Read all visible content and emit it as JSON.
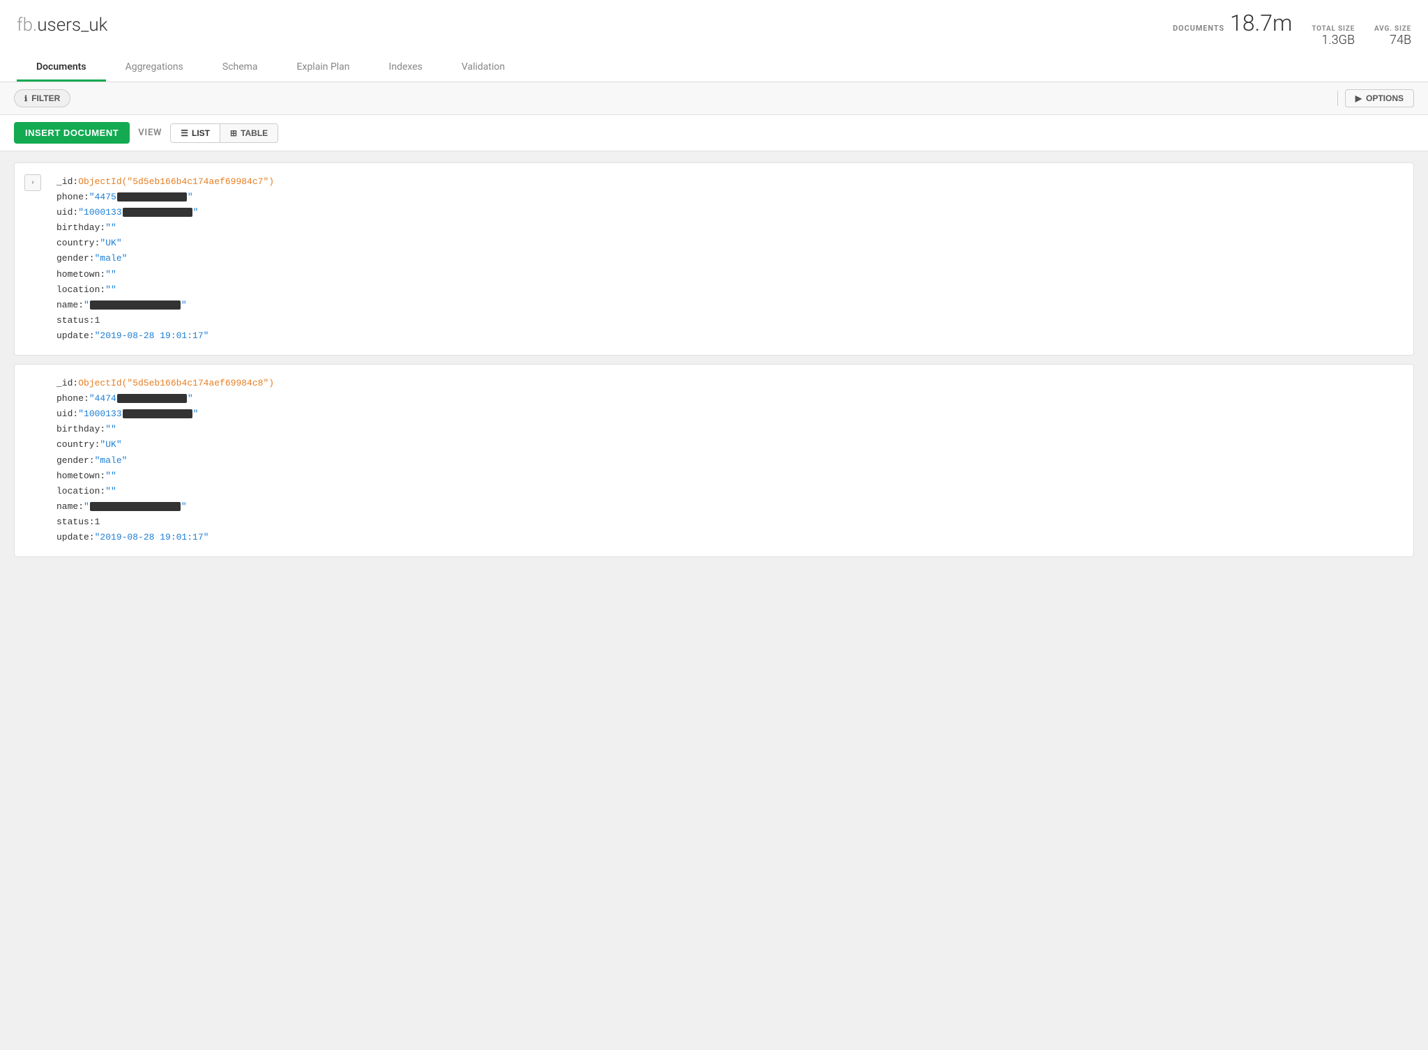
{
  "header": {
    "title_prefix": "fb.",
    "title_main": "users_uk",
    "stats": {
      "documents_label": "DOCUMENTS",
      "documents_value": "18.7m",
      "total_size_label": "TOTAL SIZE",
      "total_size_value": "1.3GB",
      "avg_size_label": "AVG. SIZE",
      "avg_size_value": "74B"
    }
  },
  "tabs": [
    {
      "id": "documents",
      "label": "Documents",
      "active": true
    },
    {
      "id": "aggregations",
      "label": "Aggregations",
      "active": false
    },
    {
      "id": "schema",
      "label": "Schema",
      "active": false
    },
    {
      "id": "explain_plan",
      "label": "Explain Plan",
      "active": false
    },
    {
      "id": "indexes",
      "label": "Indexes",
      "active": false
    },
    {
      "id": "validation",
      "label": "Validation",
      "active": false
    }
  ],
  "filter": {
    "button_label": "FILTER",
    "placeholder": "",
    "options_label": "OPTIONS"
  },
  "actions": {
    "insert_label": "INSERT DOCUMENT",
    "view_label": "VIEW",
    "list_label": "LIST",
    "table_label": "TABLE"
  },
  "documents": [
    {
      "id": "doc1",
      "fields": [
        {
          "key": "_id:",
          "value_type": "objectid",
          "value": "ObjectId(\"5d5eb166b4c174aef69984c7\")"
        },
        {
          "key": "phone:",
          "value_type": "string_redacted",
          "prefix": "\"4475",
          "suffix": "\""
        },
        {
          "key": "uid:",
          "value_type": "string_redacted",
          "prefix": "\"1000133",
          "suffix": "\""
        },
        {
          "key": "birthday:",
          "value_type": "string",
          "value": "\"\""
        },
        {
          "key": "country:",
          "value_type": "string",
          "value": "\"UK\""
        },
        {
          "key": "gender:",
          "value_type": "string",
          "value": "\"male\""
        },
        {
          "key": "hometown:",
          "value_type": "string",
          "value": "\"\""
        },
        {
          "key": "location:",
          "value_type": "string",
          "value": "\"\""
        },
        {
          "key": "name:",
          "value_type": "string_redacted_wide",
          "prefix": "\"",
          "suffix": "\""
        },
        {
          "key": "status:",
          "value_type": "number",
          "value": "1"
        },
        {
          "key": "update:",
          "value_type": "string",
          "value": "\"2019-08-28 19:01:17\""
        }
      ]
    },
    {
      "id": "doc2",
      "fields": [
        {
          "key": "_id:",
          "value_type": "objectid",
          "value": "ObjectId(\"5d5eb166b4c174aef69984c8\")"
        },
        {
          "key": "phone:",
          "value_type": "string_redacted",
          "prefix": "\"4474",
          "suffix": "\""
        },
        {
          "key": "uid:",
          "value_type": "string_redacted",
          "prefix": "\"1000133",
          "suffix": "\""
        },
        {
          "key": "birthday:",
          "value_type": "string",
          "value": "\"\""
        },
        {
          "key": "country:",
          "value_type": "string",
          "value": "\"UK\""
        },
        {
          "key": "gender:",
          "value_type": "string",
          "value": "\"male\""
        },
        {
          "key": "hometown:",
          "value_type": "string",
          "value": "\"\""
        },
        {
          "key": "location:",
          "value_type": "string",
          "value": "\"\""
        },
        {
          "key": "name:",
          "value_type": "string_redacted_wide",
          "prefix": "\"",
          "suffix": "\""
        },
        {
          "key": "status:",
          "value_type": "number",
          "value": "1"
        },
        {
          "key": "update:",
          "value_type": "string",
          "value": "\"2019-08-28 19:01:17\""
        }
      ]
    }
  ],
  "colors": {
    "active_tab": "#13aa52",
    "insert_button": "#13aa52",
    "objectid": "#e67e22",
    "string": "#1c7ed6"
  }
}
